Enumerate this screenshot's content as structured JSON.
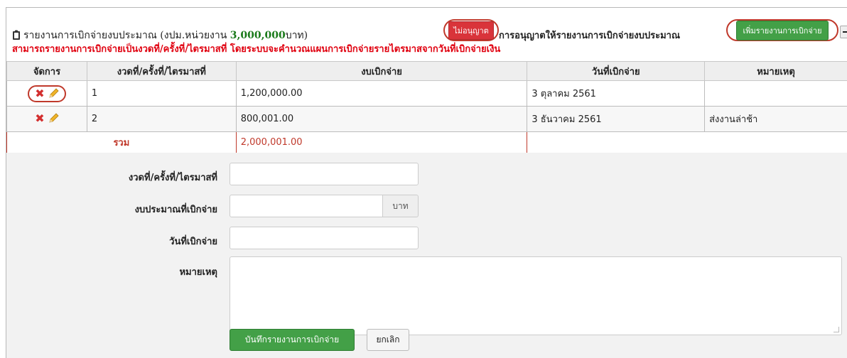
{
  "header": {
    "title_prefix": "รายงานการเบิกจ่ายงบประมาณ (งปม.หน่วยงาน ",
    "title_budget": "3,000,000",
    "title_suffix": "บาท)",
    "warning": "สามารถรายงานการเบิกจ่ายเป็นงวดที่/ครั้งที่/ไตรมาสที่ โดยระบบจะคำนวณแผนการเบิกจ่ายรายไตรมาสจากวันที่เบิกจ่ายเงิน",
    "deny_label": "ไม่อนุญาต",
    "permit_text": "การอนุญาตให้รายงานการเบิกจ่ายงบประมาณ",
    "add_button_label": "เพิ่มรายงานการเบิกจ่าย",
    "icons": {
      "title": "clipboard-icon",
      "collapse": "minus-icon"
    }
  },
  "table": {
    "columns": [
      "จัดการ",
      "งวดที่/ครั้งที่/ไตรมาสที่",
      "งบเบิกจ่าย",
      "วันที่เบิกจ่าย",
      "หมายเหตุ"
    ],
    "rows": [
      {
        "period": "1",
        "amount": "1,200,000.00",
        "date": "3 ตุลาคม 2561",
        "note": ""
      },
      {
        "period": "2",
        "amount": "800,001.00",
        "date": "3 ธันวาคม 2561",
        "note": "ส่งงานล่าช้า"
      }
    ],
    "total_label": "รวม",
    "total_value": "2,000,001.00",
    "row_icons": [
      "delete-icon",
      "edit-icon"
    ]
  },
  "form": {
    "period_label": "งวดที่/ครั้งที่/ไตรมาสที่",
    "period_value": "",
    "budget_label": "งบประมาณที่เบิกจ่าย",
    "budget_value": "",
    "budget_unit": "บาท",
    "date_label": "วันที่เบิกจ่าย",
    "date_value": "",
    "note_label": "หมายเหตุ",
    "note_value": "",
    "save_label": "บันทึกรายงานการเบิกจ่าย",
    "cancel_label": "ยกเลิก"
  },
  "colors": {
    "warning": "#e0000f",
    "budget_green": "#1a7a1a",
    "deny_red": "#d9343a",
    "add_green": "#43a047",
    "highlight_circle": "#c0392b",
    "total_red": "#c0392b"
  }
}
